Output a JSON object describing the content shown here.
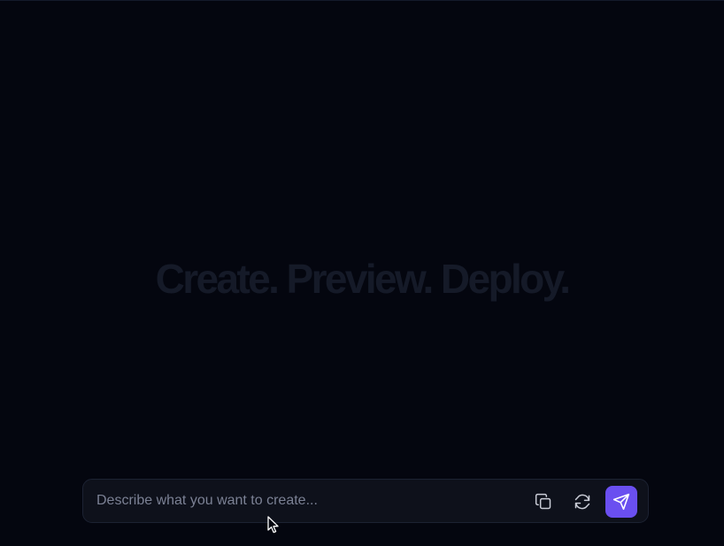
{
  "hero": {
    "headline": "Create. Preview. Deploy."
  },
  "composer": {
    "placeholder": "Describe what you want to create...",
    "value": ""
  },
  "icons": {
    "copy": "copy-icon",
    "refresh": "refresh-icon",
    "send": "send-icon",
    "cursor": "mouse-pointer-icon"
  },
  "colors": {
    "background": "#04060f",
    "composer_background": "#0e111b",
    "composer_border": "#1c2232",
    "send_button": "#6a4ff0",
    "headline": "#151a28",
    "placeholder": "#7b8194"
  }
}
